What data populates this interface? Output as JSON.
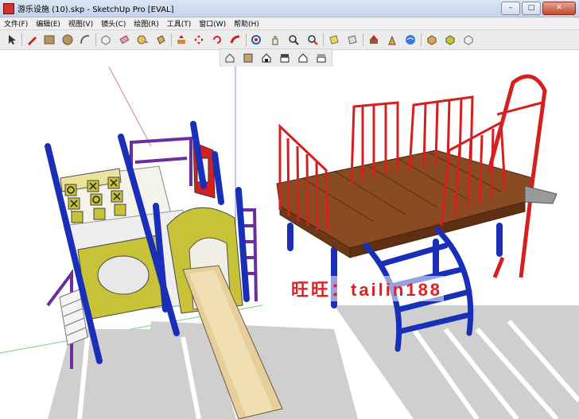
{
  "window": {
    "title": "游乐设施 (10).skp - SketchUp Pro [EVAL]",
    "min_label": "–",
    "max_label": "□",
    "close_label": "✕"
  },
  "menu": {
    "items": [
      "文件(F)",
      "编辑(E)",
      "视图(V)",
      "镜头(C)",
      "绘图(R)",
      "工具(T)",
      "窗口(W)",
      "帮助(H)"
    ]
  },
  "toolbar": {
    "main_icons": [
      "select-icon",
      "pencil-icon",
      "rectangle-icon",
      "circle-icon",
      "arc-icon",
      "make-component-icon",
      "eraser-icon",
      "tape-measure-icon",
      "paint-bucket-icon",
      "push-pull-icon",
      "move-icon",
      "rotate-icon",
      "follow-me-icon",
      "orbit-icon",
      "pan-icon",
      "zoom-icon",
      "zoom-extents-icon",
      "section-plane-icon",
      "section-display-icon",
      "add-location-icon",
      "place-model-icon",
      "get-models-icon",
      "share-model-icon",
      "component-icon",
      "extension-icon",
      "photo-texture-icon"
    ],
    "view_icons": [
      "iso-view-icon",
      "top-view-icon",
      "front-view-icon",
      "right-view-icon",
      "back-view-icon",
      "left-view-icon"
    ]
  },
  "viewport": {
    "watermark": "旺旺：tailin188"
  },
  "colors": {
    "frame_blue": "#1a2fb8",
    "panel_yellow": "#c8c238",
    "deck_wood": "#8a4a22",
    "rail_red": "#d42020",
    "slide_tan": "#e6cf9a",
    "purple_rail": "#6a2e9e"
  }
}
